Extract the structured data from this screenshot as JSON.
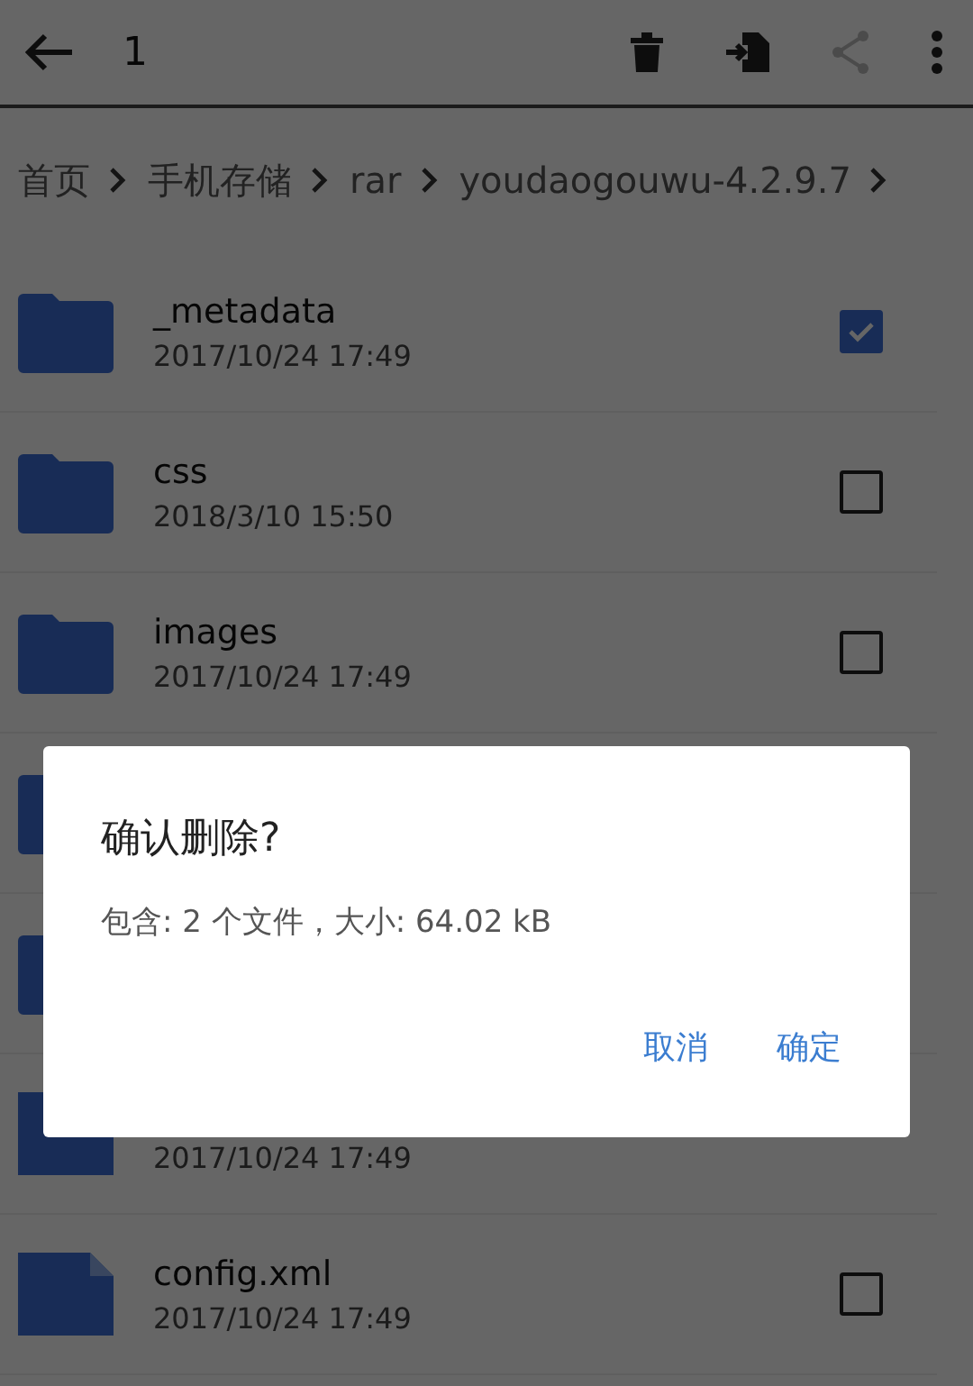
{
  "toolbar": {
    "selected_count": "1",
    "actions": [
      {
        "kind": "delete",
        "disabled": false
      },
      {
        "kind": "move",
        "disabled": false
      },
      {
        "kind": "share",
        "disabled": true
      },
      {
        "kind": "more",
        "disabled": false
      }
    ]
  },
  "breadcrumb": [
    "首页",
    "手机存储",
    "rar",
    "youdaogouwu-4.2.9.7"
  ],
  "files": [
    {
      "kind": "folder",
      "name": "_metadata",
      "modified": "2017/10/24 17:49",
      "checked": true
    },
    {
      "kind": "folder",
      "name": "css",
      "modified": "2018/3/10 15:50",
      "checked": false
    },
    {
      "kind": "folder",
      "name": "images",
      "modified": "2017/10/24 17:49",
      "checked": false
    },
    {
      "kind": "folder"
    },
    {
      "kind": "folder"
    },
    {
      "kind": "file",
      "modified": "2017/10/24 17:49"
    },
    {
      "kind": "file",
      "name": "config.xml",
      "modified": "2017/10/24 17:49",
      "checked": false
    }
  ],
  "dialog": {
    "title": "确认删除?",
    "message": "包含: 2 个文件，大小: 64.02 kB",
    "buttons": [
      "取消",
      "确定"
    ]
  }
}
